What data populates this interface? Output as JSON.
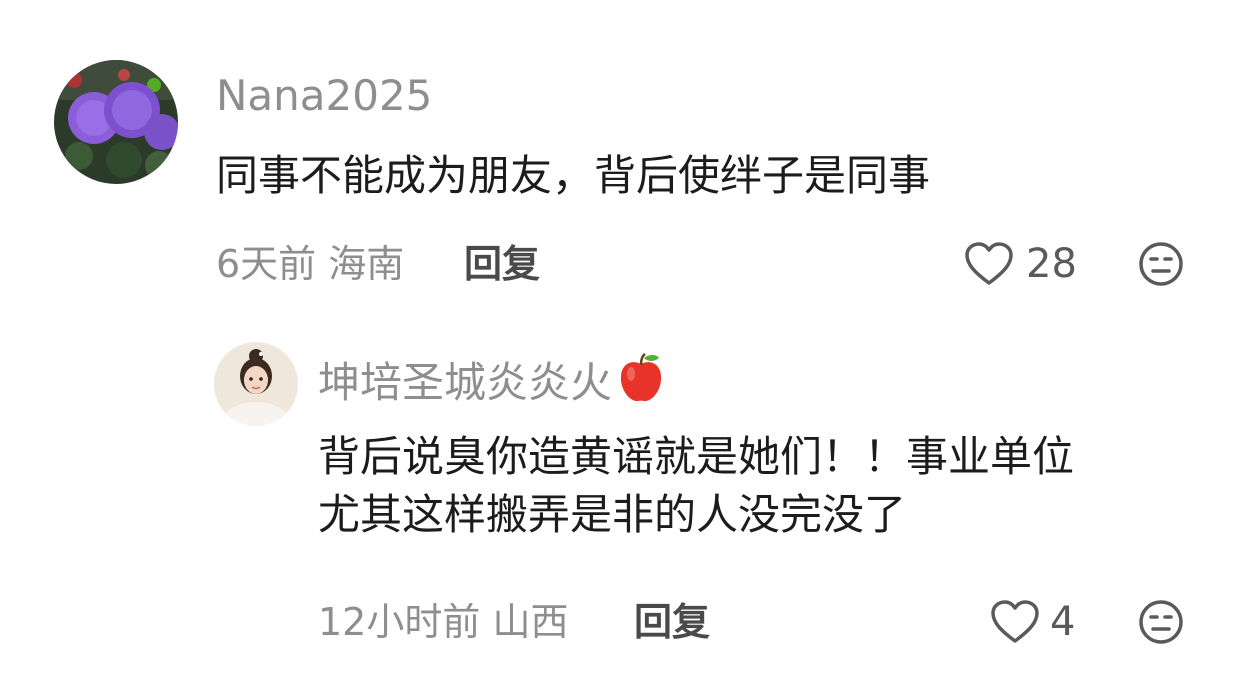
{
  "comments": [
    {
      "username": "Nana2025",
      "text": "同事不能成为朋友，背后使绊子是同事",
      "time": "6天前",
      "location": "海南",
      "reply_label": "回复",
      "likes": "28",
      "avatar_icon": "purple-chrysanthemum-avatar",
      "like_icon": "heart-outline-icon",
      "dislike_icon": "meh-face-icon"
    },
    {
      "username": "坤培圣城炎炎火",
      "username_badge_icon": "apple-emoji-icon",
      "text_line1": "背后说臭你造黄谣就是她们！！事业单位",
      "text_line2": "尤其这样搬弄是非的人没完没了",
      "time": "12小时前",
      "location": "山西",
      "reply_label": "回复",
      "likes": "4",
      "avatar_icon": "cartoon-bride-avatar",
      "like_icon": "heart-outline-icon",
      "dislike_icon": "meh-face-icon"
    }
  ],
  "colors": {
    "username": "#8e8e8e",
    "text": "#1c1c1c",
    "meta": "#8e8e8e",
    "reply": "#4a4a4a",
    "icon": "#5a5a5a"
  }
}
